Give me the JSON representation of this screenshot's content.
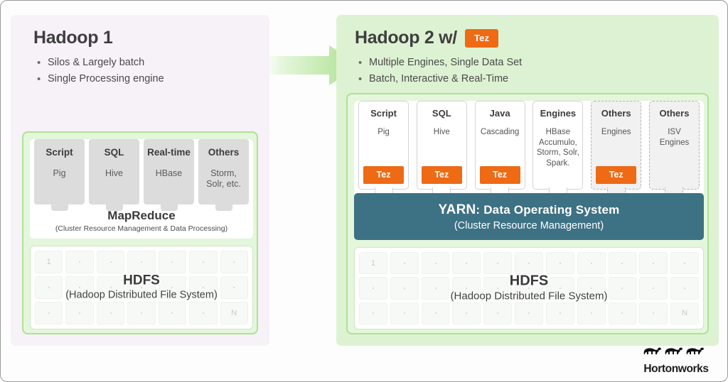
{
  "left_panel": {
    "title": "Hadoop 1",
    "bullets": [
      "Silos & Largely batch",
      "Single Processing engine"
    ],
    "columns": [
      {
        "head": "Script",
        "sub": "Pig"
      },
      {
        "head": "SQL",
        "sub": "Hive"
      },
      {
        "head": "Real-time",
        "sub": "HBase"
      },
      {
        "head": "Others",
        "sub": "Storm,\nSolr, etc."
      }
    ],
    "mapreduce": {
      "title": "MapReduce",
      "subtitle": "(Cluster Resource Management & Data Processing)"
    },
    "hdfs": {
      "title": "HDFS",
      "subtitle": "(Hadoop Distributed File System)",
      "cols": 7,
      "rows": 3,
      "first_label": "1",
      "last_label": "N"
    }
  },
  "right_panel": {
    "title": "Hadoop 2 w/",
    "title_badge": "Tez",
    "bullets": [
      "Multiple Engines, Single Data Set",
      "Batch, Interactive & Real-Time"
    ],
    "columns": [
      {
        "head": "Script",
        "sub": "Pig",
        "tez": "Tez",
        "dashed": false
      },
      {
        "head": "SQL",
        "sub": "Hive",
        "tez": "Tez",
        "dashed": false
      },
      {
        "head": "Java",
        "sub": "Cascading",
        "tez": "Tez",
        "dashed": false
      },
      {
        "head": "Engines",
        "sub": "HBase\nAccumulo,\nStorm, Solr,\nSpark.",
        "tez": null,
        "dashed": false
      },
      {
        "head": "Others",
        "sub": "Engines",
        "tez": "Tez",
        "dashed": true
      },
      {
        "head": "Others",
        "sub": "ISV\nEngines",
        "tez": null,
        "dashed": true
      }
    ],
    "yarn": {
      "name": "YARN",
      "tagline": ": Data Operating System",
      "subtitle": "(Cluster Resource Management)"
    },
    "hdfs": {
      "title": "HDFS",
      "subtitle": "(Hadoop Distributed File System)",
      "cols": 11,
      "rows": 3,
      "first_label": "1",
      "last_label": "N"
    }
  },
  "logo": {
    "wordmark": "Hortonworks",
    "icon": "three-elephants-icon"
  },
  "colors": {
    "tez_orange": "#ee6a15",
    "yarn_teal": "#3d7184",
    "panel_green": "#ddf2d2",
    "panel_lavender": "#f7f2f7",
    "frame_green_border": "#aee295"
  }
}
